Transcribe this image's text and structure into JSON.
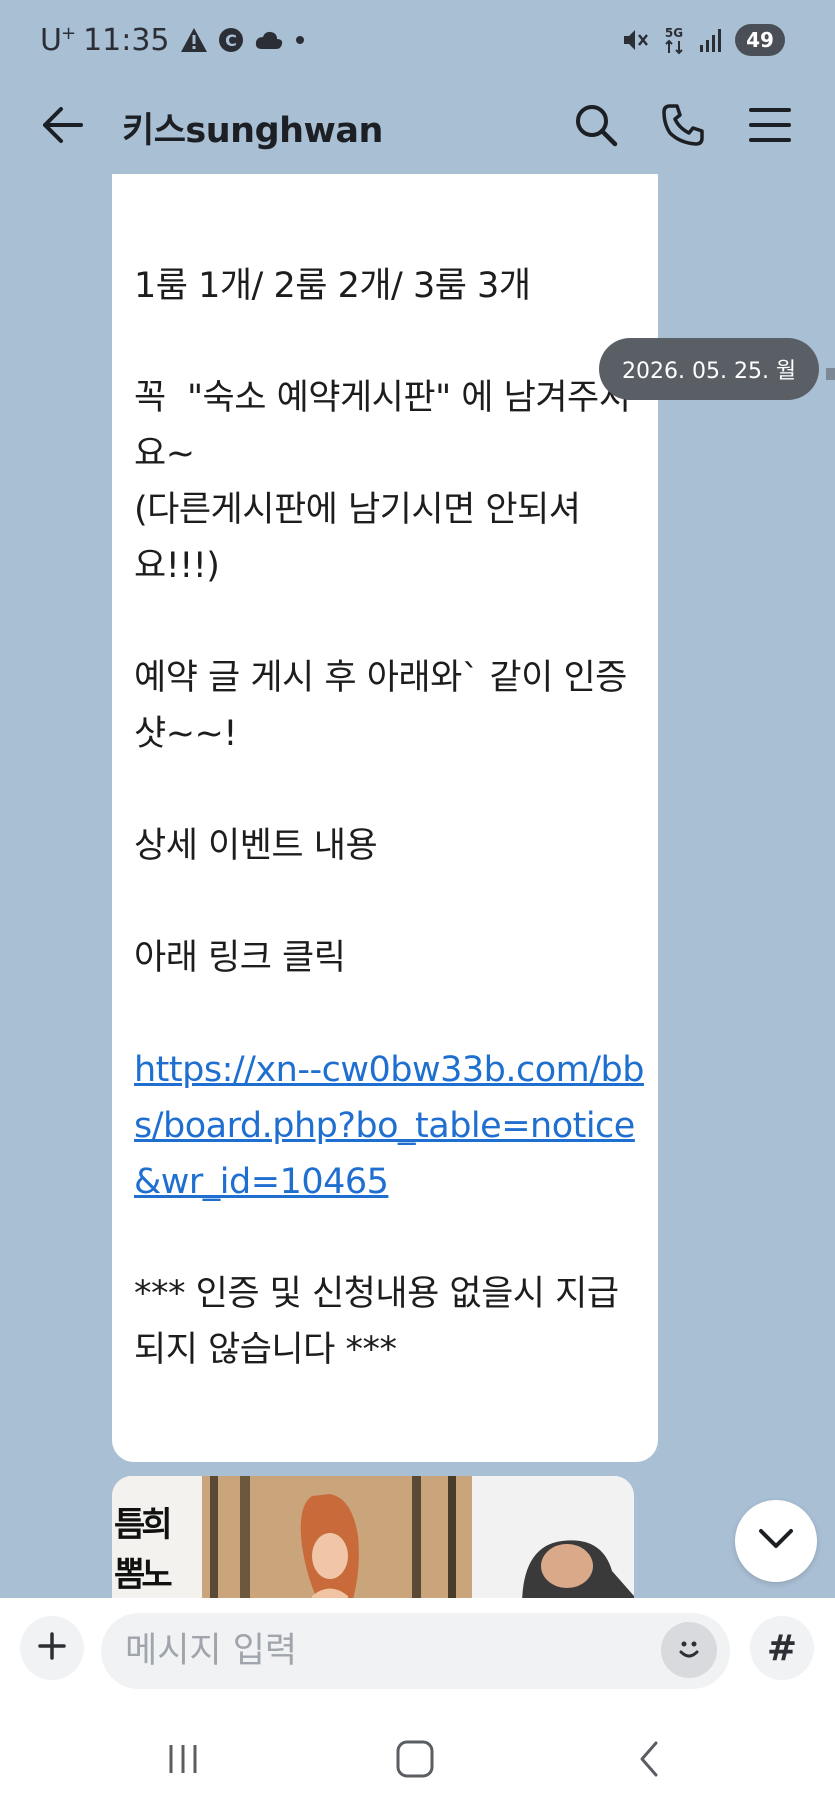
{
  "status_bar": {
    "carrier": "U",
    "carrier_sup": "+",
    "time": "11:35",
    "battery": "49"
  },
  "header": {
    "title": "키스sunghwan"
  },
  "message": {
    "text": "1룸 1개/ 2룸 2개/ 3룸 3개\n\n꼭  \"숙소 예약게시판\" 에 남겨주셔요~\n(다른게시판에 남기시면 안되셔요!!!)\n\n예약 글 게시 후 아래와` 같이 인증샷~~!\n\n상세 이벤트 내용\n\n아래 링크 클릭\n\n",
    "link": "https://xn--cw0bw33b.com/bbs/board.php?bo_table=notice&wr_id=10465",
    "footer": "\n\n*** 인증 및 신청내용 없을시 지급되지 않습니다 ***"
  },
  "date_badge": "2026. 05. 25. 월",
  "image_msg": {
    "side_text_1": "희",
    "side_text_2": "노",
    "left_text_1": "틈",
    "left_text_2": "뽐"
  },
  "input": {
    "placeholder": "메시지 입력",
    "hash": "#"
  },
  "colors": {
    "chat_bg": "#a9bfd4",
    "bubble": "#ffffff",
    "link": "#1f6fd1",
    "badge": "#5a5f66"
  },
  "icons": [
    "warning-icon",
    "c-icon",
    "cloud-icon",
    "mute-icon",
    "5g-icon",
    "signal-icon",
    "back-arrow-icon",
    "search-icon",
    "phone-icon",
    "menu-icon",
    "chevron-down-icon",
    "plus-icon",
    "emoji-icon",
    "recent-apps-icon",
    "home-icon",
    "nav-back-icon"
  ]
}
